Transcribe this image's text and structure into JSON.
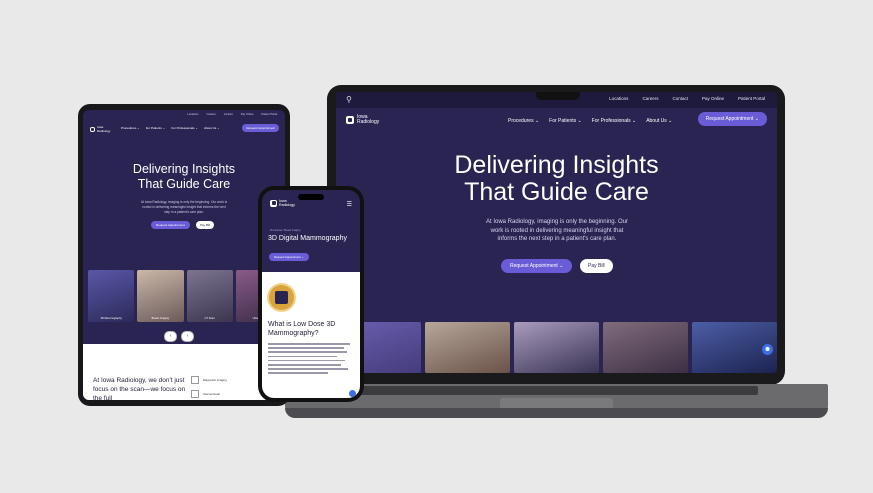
{
  "laptop": {
    "utility_links": [
      "Locations",
      "Careers",
      "Contact",
      "Pay Online",
      "Patient Portal"
    ],
    "logo": {
      "line1": "Iowa",
      "line2": "Radiology"
    },
    "menu": [
      "Procedures ⌄",
      "For Patients ⌄",
      "For Professionals ⌄",
      "About Us ⌄"
    ],
    "cta": "Request Appointment ⌄",
    "hero_title_line1": "Delivering Insights",
    "hero_title_line2": "That Guide Care",
    "hero_sub": "At Iowa Radiology, imaging is only the beginning. Our work is rooted in delivering meaningful insight that informs the next step in a patient's care plan.",
    "btn_primary": "Request Appointment ⌄",
    "btn_secondary": "Pay Bill",
    "icons": {
      "search": "search-icon",
      "help": "accessibility-icon"
    }
  },
  "tablet": {
    "utility_links": [
      "Locations",
      "Careers",
      "Contact",
      "Pay Online",
      "Patient Portal"
    ],
    "logo": {
      "line1": "Iowa",
      "line2": "Radiology"
    },
    "menu": [
      "Procedures ⌄",
      "For Patients ⌄",
      "For Professionals ⌄",
      "About Us ⌄"
    ],
    "cta": "Request Appointment",
    "hero_title_line1": "Delivering Insights",
    "hero_title_line2": "That Guide Care",
    "hero_sub": "At Iowa Radiology, imaging is only the beginning. Our work is rooted in delivering meaningful insight that informs the next step in a patient's care plan.",
    "btn_primary": "Request Appointment",
    "btn_secondary": "Pay Bill",
    "cards": [
      "3D Mammography",
      "Breast Imaging",
      "CT Scan",
      "Ultrasound"
    ],
    "lower_text": "At Iowa Radiology, we don't just focus on the scan—we focus on the full",
    "lower_right": [
      "Diagnostic Imaging",
      "Interventional"
    ]
  },
  "phone": {
    "logo": {
      "line1": "Iowa",
      "line2": "Radiology"
    },
    "breadcrumb": "Procedures / Breast Imaging",
    "title": "3D Digital Mammography",
    "btn": "Request Appointment ⌄",
    "heading": "What is Low Dose 3D Mammography?"
  },
  "colors": {
    "brand_navy": "#2a2452",
    "accent_purple": "#6a5cd6",
    "badge_gold": "#d9a43e",
    "help_blue": "#3e6ee0"
  }
}
